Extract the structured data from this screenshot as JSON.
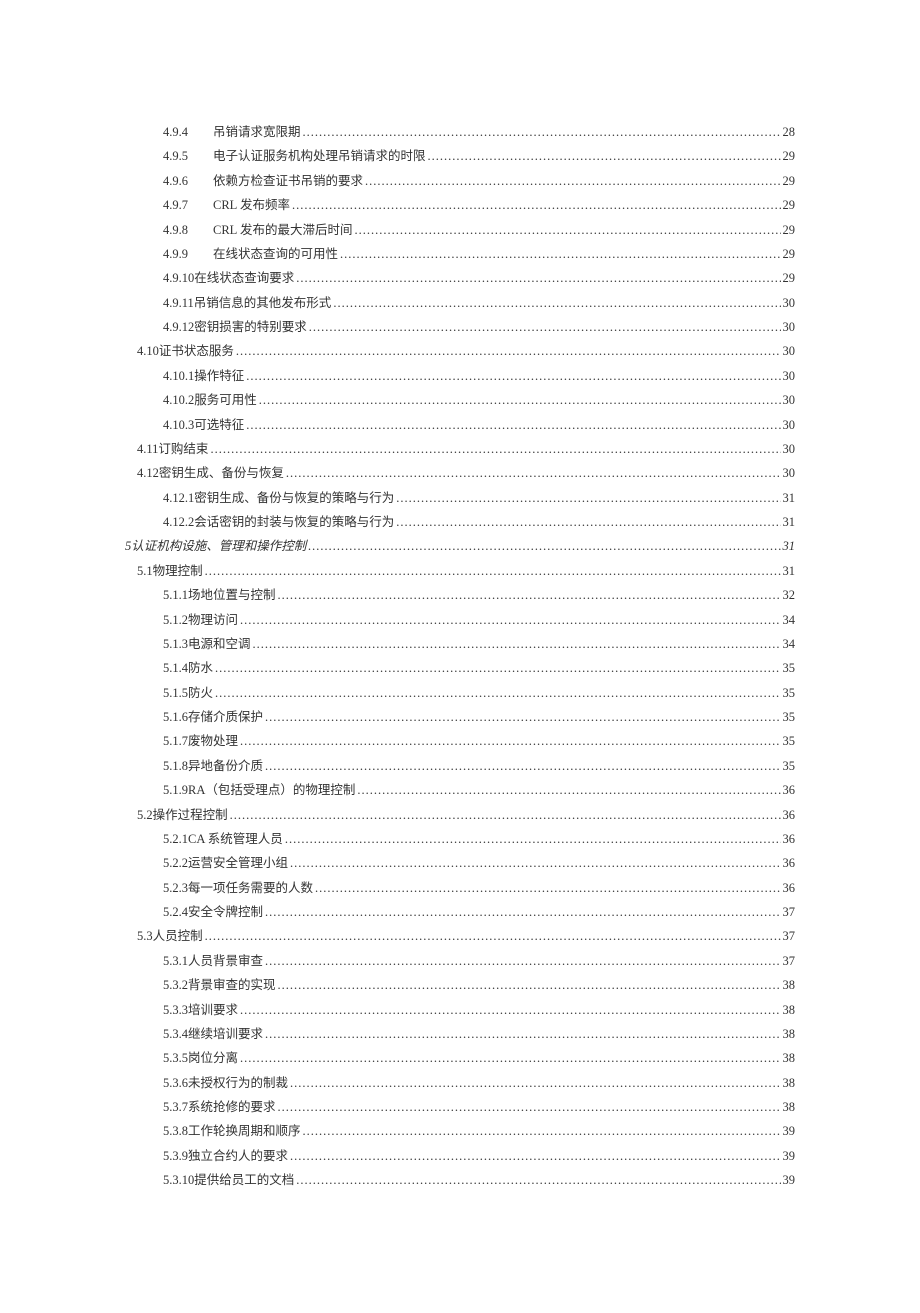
{
  "toc": [
    {
      "level": "level-2",
      "num": "4.9.4",
      "num_fixed": true,
      "title": "吊销请求宽限期",
      "page": "28"
    },
    {
      "level": "level-2",
      "num": "4.9.5",
      "num_fixed": true,
      "title": "电子认证服务机构处理吊销请求的时限",
      "page": "29"
    },
    {
      "level": "level-2",
      "num": "4.9.6",
      "num_fixed": true,
      "title": "依赖方检查证书吊销的要求",
      "page": "29"
    },
    {
      "level": "level-2",
      "num": "4.9.7",
      "num_fixed": true,
      "title": "CRL 发布频率",
      "page": "29"
    },
    {
      "level": "level-2",
      "num": "4.9.8",
      "num_fixed": true,
      "title": "CRL 发布的最大滞后时间",
      "page": "29"
    },
    {
      "level": "level-2",
      "num": "4.9.9",
      "num_fixed": true,
      "title": "在线状态查询的可用性",
      "page": "29"
    },
    {
      "level": "level-2b",
      "num": "4.9.10 ",
      "title": "在线状态查询要求",
      "page": "29"
    },
    {
      "level": "level-2b",
      "num": "4.9.11 ",
      "title": "吊销信息的其他发布形式",
      "page": "30"
    },
    {
      "level": "level-2b",
      "num": "4.9.12 ",
      "title": "密钥损害的特别要求",
      "page": "30"
    },
    {
      "level": "level-1",
      "num": "4.10 ",
      "title": "证书状态服务 ",
      "page": "30"
    },
    {
      "level": "level-2b",
      "num": "4.10.1 ",
      "title": "操作特征",
      "page": "30"
    },
    {
      "level": "level-2b",
      "num": "4.10.2 ",
      "title": "服务可用性",
      "page": "30"
    },
    {
      "level": "level-2b",
      "num": "4.10.3 ",
      "title": "可选特征",
      "page": "30"
    },
    {
      "level": "level-1",
      "num": "4.11 ",
      "title": "订购结束 ",
      "page": "30"
    },
    {
      "level": "level-1",
      "num": "4.12 ",
      "title": "密钥生成、备份与恢复 ",
      "page": "30"
    },
    {
      "level": "level-2b",
      "num": "4.12.1 ",
      "title": "密钥生成、备份与恢复的策略与行为",
      "page": "31"
    },
    {
      "level": "level-2b",
      "num": "4.12.2 ",
      "title": "会话密钥的封装与恢复的策略与行为",
      "page": "31"
    },
    {
      "level": "level-0",
      "num": "5 ",
      "title": "认证机构设施、管理和操作控制 ",
      "page": "31"
    },
    {
      "level": "level-1",
      "num": "5.1 ",
      "title": "物理控制 ",
      "page": "31"
    },
    {
      "level": "level-2b",
      "num": "5.1.1 ",
      "title": "场地位置与控制",
      "page": "32"
    },
    {
      "level": "level-2b",
      "num": "5.1.2 ",
      "title": "物理访问",
      "page": "34"
    },
    {
      "level": "level-2b",
      "num": "5.1.3 ",
      "title": "电源和空调",
      "page": "34"
    },
    {
      "level": "level-2b",
      "num": "5.1.4 ",
      "title": "防水",
      "page": "35"
    },
    {
      "level": "level-2b",
      "num": "5.1.5 ",
      "title": "防火",
      "page": "35"
    },
    {
      "level": "level-2b",
      "num": "5.1.6 ",
      "title": "存储介质保护",
      "page": "35"
    },
    {
      "level": "level-2b",
      "num": "5.1.7 ",
      "title": "废物处理",
      "page": "35"
    },
    {
      "level": "level-2b",
      "num": "5.1.8 ",
      "title": "异地备份介质",
      "page": "35"
    },
    {
      "level": "level-2b",
      "num": "5.1.9",
      "title": "RA（包括受理点）的物理控制",
      "page": "36"
    },
    {
      "level": "level-1",
      "num": "5.2 ",
      "title": "操作过程控制 ",
      "page": "36"
    },
    {
      "level": "level-2b",
      "num": "5.2.1 ",
      "title": "CA 系统管理人员 ",
      "page": "36"
    },
    {
      "level": "level-2b",
      "num": "5.2.2 ",
      "title": "运营安全管理小组",
      "page": "36"
    },
    {
      "level": "level-2b",
      "num": "5.2.3 ",
      "title": "每一项任务需要的人数",
      "page": "36"
    },
    {
      "level": "level-2b",
      "num": "5.2.4 ",
      "title": "安全令牌控制",
      "page": "37"
    },
    {
      "level": "level-1",
      "num": "5.3 ",
      "title": "人员控制 ",
      "page": "37"
    },
    {
      "level": "level-2b",
      "num": "5.3.1 ",
      "title": "人员背景审查",
      "page": "37"
    },
    {
      "level": "level-2b",
      "num": "5.3.2 ",
      "title": "背景审查的实现",
      "page": "38"
    },
    {
      "level": "level-2b",
      "num": "5.3.3 ",
      "title": "培训要求",
      "page": "38"
    },
    {
      "level": "level-2b",
      "num": "5.3.4 ",
      "title": "继续培训要求",
      "page": "38"
    },
    {
      "level": "level-2b",
      "num": "5.3.5 ",
      "title": "岗位分离",
      "page": "38"
    },
    {
      "level": "level-2b",
      "num": "5.3.6 ",
      "title": "未授权行为的制裁",
      "page": "38"
    },
    {
      "level": "level-2b",
      "num": "5.3.7 ",
      "title": "系统抢修的要求",
      "page": "38"
    },
    {
      "level": "level-2b",
      "num": "5.3.8 ",
      "title": "工作轮换周期和顺序",
      "page": "39"
    },
    {
      "level": "level-2b",
      "num": "5.3.9 ",
      "title": "独立合约人的要求",
      "page": "39"
    },
    {
      "level": "level-2b",
      "num": "5.3.10 ",
      "title": "提供给员工的文档",
      "page": "39"
    }
  ]
}
